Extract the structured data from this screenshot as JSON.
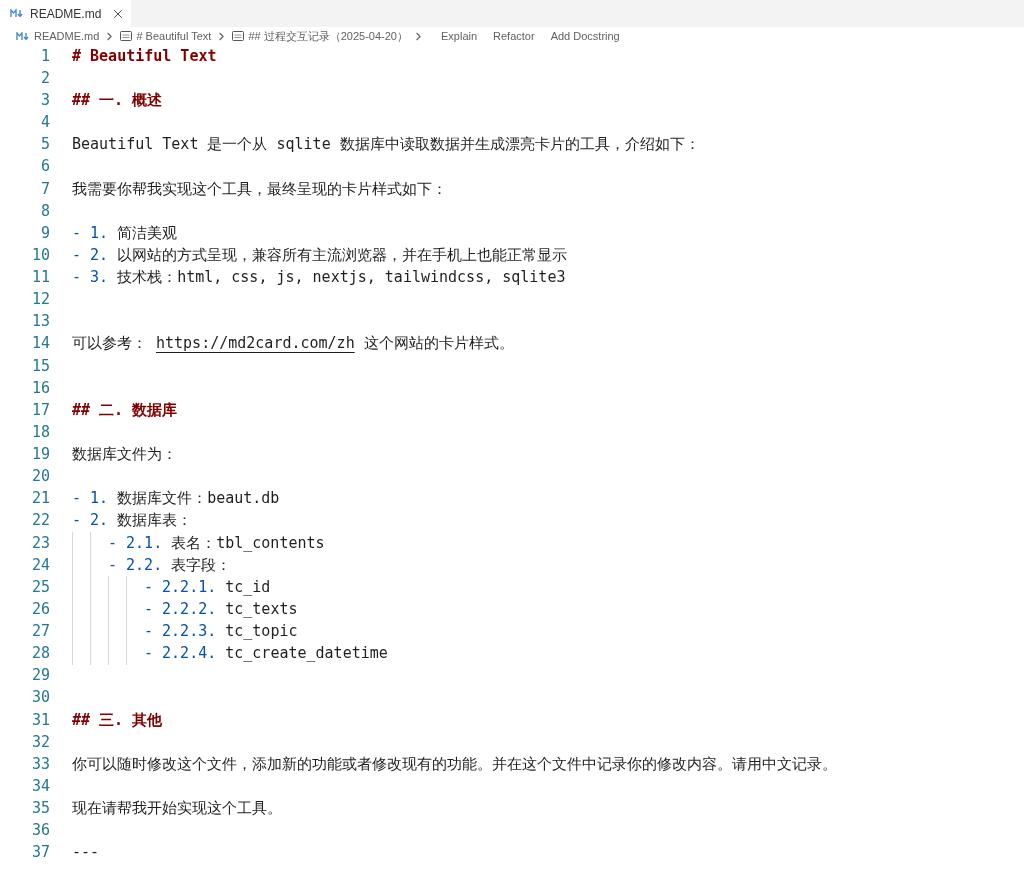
{
  "tabs": [
    {
      "label": "README.md",
      "selected": true
    }
  ],
  "breadcrumb": {
    "file": "README.md",
    "symbols": [
      "# Beautiful Text",
      "## 过程交互记录（2025-04-20）"
    ],
    "actions": [
      "Explain",
      "Refactor",
      "Add Docstring"
    ]
  },
  "lines": [
    {
      "number": "1",
      "tokens": [
        {
          "kind": "heading",
          "text": "# Beautiful Text"
        }
      ]
    },
    {
      "number": "2"
    },
    {
      "number": "3",
      "tokens": [
        {
          "kind": "heading",
          "text": "## 一. 概述"
        }
      ]
    },
    {
      "number": "4"
    },
    {
      "number": "5",
      "tokens": [
        {
          "kind": "text",
          "text": "Beautiful Text 是一个从 sqlite 数据库中读取数据并生成漂亮卡片的工具，介绍如下："
        }
      ]
    },
    {
      "number": "6"
    },
    {
      "number": "7",
      "tokens": [
        {
          "kind": "text",
          "text": "我需要你帮我实现这个工具，最终呈现的卡片样式如下："
        }
      ]
    },
    {
      "number": "8"
    },
    {
      "number": "9",
      "tokens": [
        {
          "kind": "bullet",
          "text": "- 1."
        },
        {
          "kind": "text",
          "text": "简洁美观"
        }
      ]
    },
    {
      "number": "10",
      "tokens": [
        {
          "kind": "bullet",
          "text": "- 2."
        },
        {
          "kind": "text",
          "text": "以网站的方式呈现，兼容所有主流浏览器，并在手机上也能正常显示"
        }
      ]
    },
    {
      "number": "11",
      "tokens": [
        {
          "kind": "bullet",
          "text": "- 3."
        },
        {
          "kind": "text",
          "text": "技术栈：html, css, js, nextjs, tailwindcss, sqlite3"
        }
      ]
    },
    {
      "number": "12"
    },
    {
      "number": "13"
    },
    {
      "number": "14",
      "tokens": [
        {
          "kind": "text",
          "text": "可以参考："
        },
        {
          "kind": "link",
          "text": "https://md2card.com/zh"
        },
        {
          "kind": "text",
          "text": "这个网站的卡片样式。"
        }
      ]
    },
    {
      "number": "15"
    },
    {
      "number": "16"
    },
    {
      "number": "17",
      "tokens": [
        {
          "kind": "heading",
          "text": "## 二. 数据库"
        }
      ]
    },
    {
      "number": "18"
    },
    {
      "number": "19",
      "tokens": [
        {
          "kind": "text",
          "text": "数据库文件为："
        }
      ]
    },
    {
      "number": "20"
    },
    {
      "number": "21",
      "tokens": [
        {
          "kind": "bullet",
          "text": "- 1."
        },
        {
          "kind": "text",
          "text": "数据库文件：beaut.db"
        }
      ]
    },
    {
      "number": "22",
      "tokens": [
        {
          "kind": "bullet",
          "text": "- 2."
        },
        {
          "kind": "text",
          "text": "数据库表："
        }
      ],
      "children": [
        {
          "number": "23",
          "tokens": [
            {
              "kind": "bullet",
              "text": "- 2.1."
            },
            {
              "kind": "text",
              "text": "表名：tbl_contents"
            }
          ]
        },
        {
          "number": "24",
          "tokens": [
            {
              "kind": "bullet",
              "text": "- 2.2."
            },
            {
              "kind": "text",
              "text": "表字段："
            }
          ],
          "children": [
            {
              "number": "25",
              "tokens": [
                {
                  "kind": "bullet",
                  "text": "- 2.2.1."
                },
                {
                  "kind": "text",
                  "text": "tc_id"
                }
              ]
            },
            {
              "number": "26",
              "tokens": [
                {
                  "kind": "bullet",
                  "text": "- 2.2.2."
                },
                {
                  "kind": "text",
                  "text": "tc_texts"
                }
              ]
            },
            {
              "number": "27",
              "tokens": [
                {
                  "kind": "bullet",
                  "text": "- 2.2.3."
                },
                {
                  "kind": "text",
                  "text": "tc_topic"
                }
              ]
            },
            {
              "number": "28",
              "tokens": [
                {
                  "kind": "bullet",
                  "text": "- 2.2.4."
                },
                {
                  "kind": "text",
                  "text": "tc_create_datetime"
                }
              ]
            }
          ]
        }
      ]
    },
    {
      "number": "29"
    },
    {
      "number": "30"
    },
    {
      "number": "31",
      "tokens": [
        {
          "kind": "heading",
          "text": "## 三. 其他"
        }
      ]
    },
    {
      "number": "32"
    },
    {
      "number": "33",
      "tokens": [
        {
          "kind": "text",
          "text": "你可以随时修改这个文件，添加新的功能或者修改现有的功能。并在这个文件中记录你的修改内容。请用中文记录。"
        }
      ]
    },
    {
      "number": "34"
    },
    {
      "number": "35",
      "tokens": [
        {
          "kind": "text",
          "text": "现在请帮我开始实现这个工具。"
        }
      ]
    },
    {
      "number": "36"
    },
    {
      "number": "37",
      "tokens": [
        {
          "kind": "text",
          "text": "---"
        }
      ]
    }
  ]
}
